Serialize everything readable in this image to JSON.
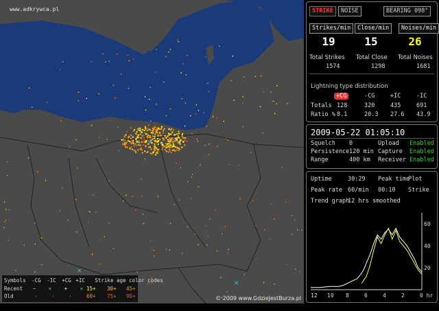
{
  "map": {
    "watermark": "www.adkrywca.pl",
    "copyright": "© 2009 www.GdzieJestBurza.pl",
    "legend": {
      "symbols_label": "Symbols",
      "types": [
        "-CG",
        "-IC",
        "+CG",
        "+IC"
      ],
      "age_label": "Strike age color codes",
      "recent_label": "Recent",
      "old_label": "Old",
      "recent_codes": [
        "15+",
        "30+",
        "45+"
      ],
      "old_codes": [
        "60+",
        "75+",
        "90+"
      ]
    }
  },
  "top_buttons": {
    "strike": "STRIKE",
    "noise": "NOISE",
    "bearing": "BEARING 098°"
  },
  "rates": {
    "strikes_label": "Strikes/min",
    "strikes_value": "19",
    "close_label": "Close/min",
    "close_value": "15",
    "noises_label": "Noises/min",
    "noises_value": "26"
  },
  "totals": {
    "strikes_label": "Total Strikes",
    "strikes_value": "1574",
    "close_label": "Total Close",
    "close_value": "1298",
    "noises_label": "Total Noises",
    "noises_value": "1681"
  },
  "distribution": {
    "title": "Lightning type distribution",
    "headers": [
      "+CG",
      "-CG",
      "+IC",
      "-IC"
    ],
    "totals_label": "Totals",
    "totals": [
      "128",
      "320",
      "435",
      "691"
    ],
    "ratio_label": "Ratio %",
    "ratios": [
      "8.1",
      "20.3",
      "27.6",
      "43.9"
    ]
  },
  "status": {
    "datetime": "2009-05-22 01:05:10",
    "rows": [
      {
        "k1": "Squelch",
        "v1": "0",
        "k2": "Upload",
        "v2": "Enabled"
      },
      {
        "k1": "Persistence",
        "v1": "120 min",
        "k2": "Capture",
        "v2": "Enabled"
      },
      {
        "k1": "Range",
        "v1": "400 km",
        "k2": "Receiver",
        "v2": "Enabled"
      }
    ]
  },
  "graph_panel": {
    "uptime_label": "Uptime",
    "uptime_value": "30:29",
    "peaktime_label": "Peak time",
    "plot_label": "Plot",
    "peakrate_label": "Peak rate",
    "peakrate_value": "60/min",
    "peaktime_value": "00:10",
    "plot_value": "Strike",
    "trend_label": "Trend graph",
    "trend_value": "12 hrs smoothed"
  },
  "chart_data": {
    "type": "line",
    "title": "",
    "xlabel": "hr",
    "ylabel": "",
    "xlim": [
      12,
      0
    ],
    "ylim": [
      0,
      70
    ],
    "x_ticks": [
      "12",
      "10",
      "8",
      "6",
      "4",
      "2",
      "0 hr"
    ],
    "y_ticks": [
      "60",
      "40",
      "20"
    ],
    "grid": false,
    "series": [
      {
        "color": "#ffffff",
        "x": [
          12,
          11,
          10,
          9,
          8.5,
          8,
          7.5,
          7,
          6.6,
          6.3,
          6,
          5.6,
          5.2,
          4.8,
          4.4,
          4,
          3.6,
          3.2,
          2.8,
          2.4,
          2,
          1.6,
          1.2,
          0.8,
          0.4,
          0
        ],
        "y": [
          2,
          2,
          3,
          3,
          4,
          6,
          8,
          10,
          14,
          18,
          24,
          32,
          42,
          50,
          46,
          52,
          55,
          50,
          56,
          48,
          44,
          40,
          34,
          28,
          20,
          16
        ]
      },
      {
        "color": "#ffff33",
        "x": [
          6.5,
          6,
          5.6,
          5.2,
          4.8,
          4.4,
          4,
          3.6,
          3.2,
          2.8,
          2.4,
          2,
          1.6,
          1.2,
          0.8,
          0.4,
          0
        ],
        "y": [
          6,
          12,
          22,
          36,
          48,
          42,
          50,
          56,
          46,
          54,
          44,
          40,
          36,
          30,
          24,
          18,
          14
        ]
      }
    ]
  }
}
